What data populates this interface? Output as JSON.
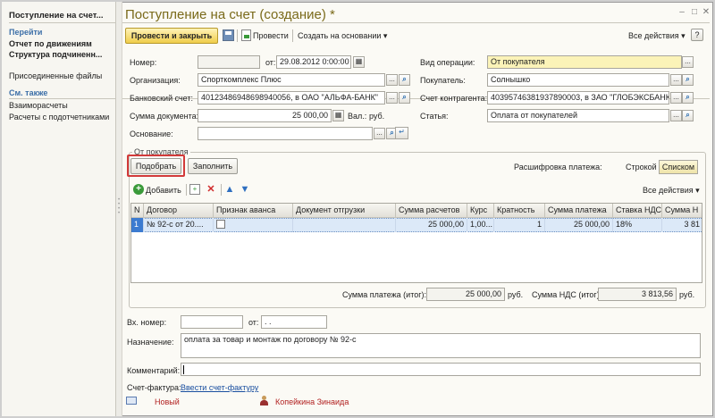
{
  "sidebar": {
    "doc_title": "Поступление на счет...",
    "goto_header": "Перейти",
    "items": [
      {
        "label": "Отчет по движениям",
        "bold": true
      },
      {
        "label": "Структура подчиненн...",
        "bold": true
      },
      {
        "label": "Присоединенные файлы",
        "bold": false
      }
    ],
    "see_also_header": "См. также",
    "see_also_items": [
      {
        "label": "Взаиморасчеты"
      },
      {
        "label": "Расчеты с подотчетниками"
      }
    ]
  },
  "header": {
    "title": "Поступление на счет (создание) *"
  },
  "toolbar": {
    "post_close": "Провести и закрыть",
    "post": "Провести",
    "create_based": "Создать на основании ▾",
    "all_actions": "Все действия ▾",
    "help": "?"
  },
  "form": {
    "number_label": "Номер:",
    "number_value": "",
    "from_label": "от:",
    "date_value": "29.08.2012  0:00:00",
    "operation_label": "Вид операции:",
    "operation_value": "От покупателя",
    "org_label": "Организация:",
    "org_value": "Спорткомплекс Плюс",
    "buyer_label": "Покупатель:",
    "buyer_value": "Солнышко",
    "bank_label": "Банковский счет:",
    "bank_value": "40123486948698940056, в ОАО \"АЛЬФА-БАНК\"",
    "counter_label": "Счет контрагента:",
    "counter_value": "40395746381937890003, в ЗАО \"ГЛОБЭКСБАНК\"",
    "sum_label": "Сумма документа:",
    "sum_value": "25 000,00",
    "currency_label": "Вал.:",
    "currency_value": "руб.",
    "article_label": "Статья:",
    "article_value": "Оплата от покупателей",
    "basis_label": "Основание:",
    "basis_value": ""
  },
  "group": {
    "title": "От покупателя",
    "pick_button": "Подобрать",
    "fill_button": "Заполнить",
    "decode_label": "Расшифровка платежа:",
    "mode_row": "Строкой",
    "mode_list": "Списком",
    "add_button": "Добавить",
    "all_actions": "Все действия ▾"
  },
  "table": {
    "columns": [
      "N",
      "Договор",
      "Признак аванса",
      "Документ отгрузки",
      "Сумма расчетов",
      "Курс",
      "Кратность",
      "Сумма платежа",
      "Ставка НДС",
      "Сумма Н"
    ],
    "rows": [
      {
        "n": "1",
        "contract": "№ 92-с от 20....",
        "advance": "",
        "shipment": "",
        "calc_sum": "25 000,00",
        "rate": "1,00...",
        "multiplicity": "1",
        "payment_sum": "25 000,00",
        "vat_rate": "18%",
        "vat_sum": "3 81"
      }
    ]
  },
  "totals": {
    "payment_label": "Сумма платежа (итог):",
    "payment_value": "25 000,00",
    "payment_currency": "руб.",
    "vat_label": "Сумма НДС (итог):",
    "vat_value": "3 813,56",
    "vat_currency": "руб."
  },
  "bottom": {
    "in_number_label": "Вх. номер:",
    "in_number_value": "",
    "in_from_label": "от:",
    "in_date_value": ". .",
    "purpose_label": "Назначение:",
    "purpose_value": "оплата за товар и монтаж по договору № 92-с",
    "comment_label": "Комментарий:",
    "comment_value": "",
    "invoice_label": "Счет-фактура:",
    "invoice_link": "Ввести счет-фактуру",
    "status_new": "Новый",
    "author": "Копейкина Зинаида"
  },
  "colors": {
    "title": "#7a6a1a",
    "primary_button": "#f0cd4a",
    "highlight": "#d23a3a",
    "link": "#1a4fa0",
    "selected_row": "#dce9f8"
  }
}
